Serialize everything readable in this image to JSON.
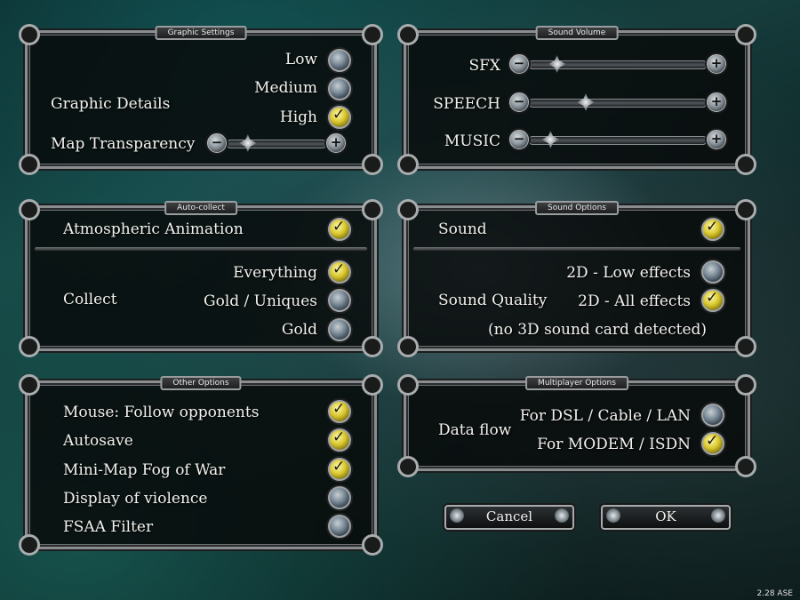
{
  "graphic": {
    "title": "Graphic Settings",
    "details_label": "Graphic Details",
    "options": [
      {
        "label": "Low",
        "checked": false
      },
      {
        "label": "Medium",
        "checked": false
      },
      {
        "label": "High",
        "checked": true
      }
    ],
    "map_transparency_label": "Map Transparency",
    "map_transparency_level": 0.15
  },
  "sound_volume": {
    "title": "Sound Volume",
    "sliders": [
      {
        "label": "SFX",
        "level": 0.12
      },
      {
        "label": "SPEECH",
        "level": 0.3
      },
      {
        "label": "MUSIC",
        "level": 0.08
      }
    ]
  },
  "auto_collect": {
    "title": "Auto-collect",
    "atmospheric_label": "Atmospheric Animation",
    "atmospheric_checked": true,
    "collect_label": "Collect",
    "options": [
      {
        "label": "Everything",
        "checked": true
      },
      {
        "label": "Gold / Uniques",
        "checked": false
      },
      {
        "label": "Gold",
        "checked": false
      }
    ]
  },
  "sound_options": {
    "title": "Sound Options",
    "sound_label": "Sound",
    "sound_checked": true,
    "quality_label": "Sound Quality",
    "options": [
      {
        "label": "2D - Low effects",
        "checked": false
      },
      {
        "label": "2D - All effects",
        "checked": true
      }
    ],
    "note": "(no 3D sound card detected)"
  },
  "other_options": {
    "title": "Other Options",
    "items": [
      {
        "label": "Mouse: Follow opponents",
        "checked": true
      },
      {
        "label": "Autosave",
        "checked": true
      },
      {
        "label": "Mini-Map Fog of War",
        "checked": true
      },
      {
        "label": "Display of violence",
        "checked": false
      },
      {
        "label": "FSAA Filter",
        "checked": false
      }
    ]
  },
  "multiplayer": {
    "title": "Multiplayer Options",
    "data_flow_label": "Data flow",
    "options": [
      {
        "label": "For DSL / Cable / LAN",
        "checked": false
      },
      {
        "label": "For MODEM / ISDN",
        "checked": true
      }
    ]
  },
  "buttons": {
    "cancel": "Cancel",
    "ok": "OK"
  },
  "version": "2.28 ASE",
  "colors": {
    "checked": "#d8c62a",
    "unchecked": "#7c8c99",
    "panel_border": "#8a8d8f"
  }
}
